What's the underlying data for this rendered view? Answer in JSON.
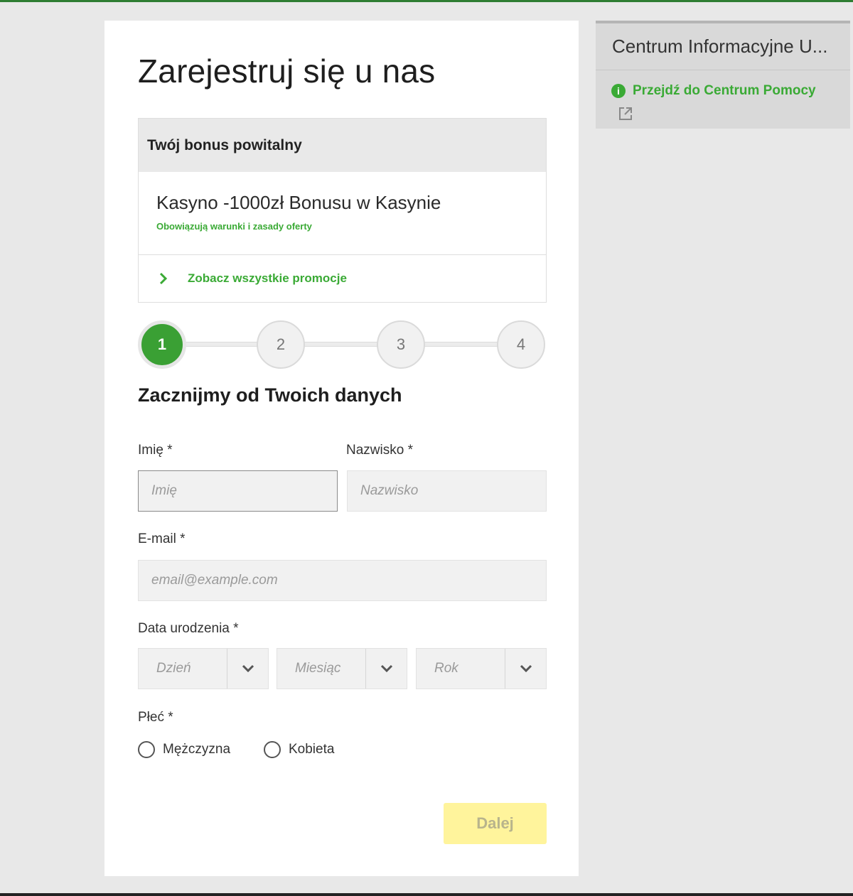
{
  "page": {
    "title": "Zarejestruj się u nas",
    "section_title": "Zacznijmy od Twoich danych"
  },
  "bonus": {
    "header": "Twój bonus powitalny",
    "name": "Kasyno -1000zł Bonusu w Kasynie",
    "terms": "Obowiązują warunki i zasady oferty",
    "promotions_link": "Zobacz wszystkie promocje"
  },
  "stepper": {
    "steps": [
      "1",
      "2",
      "3",
      "4"
    ],
    "current_step": 1
  },
  "form": {
    "first_name": {
      "label": "Imię *",
      "placeholder": "Imię",
      "value": ""
    },
    "last_name": {
      "label": "Nazwisko *",
      "placeholder": "Nazwisko",
      "value": ""
    },
    "email": {
      "label": "E-mail *",
      "placeholder": "email@example.com",
      "value": ""
    },
    "birth_date": {
      "label": "Data urodzenia *",
      "day_placeholder": "Dzień",
      "month_placeholder": "Miesiąc",
      "year_placeholder": "Rok"
    },
    "gender": {
      "label": "Płeć *",
      "options": [
        "Mężczyzna",
        "Kobieta"
      ]
    },
    "next_button": "Dalej"
  },
  "info_panel": {
    "title": "Centrum Informacyjne U...",
    "help_link": "Przejdź do Centrum Pomocy"
  },
  "colors": {
    "brand_green": "#3aaa35",
    "top_bar": "#2e7d32",
    "button_disabled": "#fff49c"
  },
  "icons": {
    "info": "info-circle-icon",
    "external": "external-link-icon",
    "chevron_right": "chevron-right-icon",
    "chevron_down": "chevron-down-icon"
  }
}
